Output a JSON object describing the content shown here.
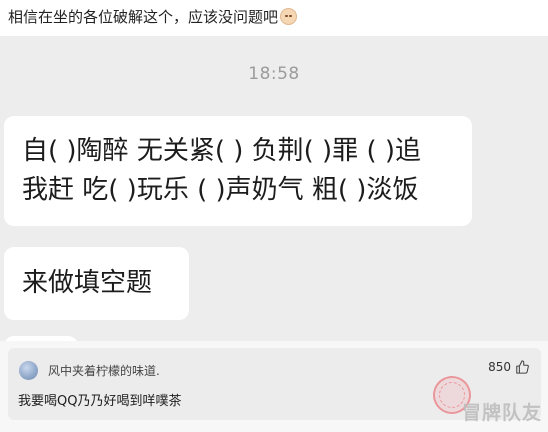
{
  "post": {
    "text": "相信在坐的各位破解这个，应该没问题吧",
    "emoji_icon": "grinning-face-icon"
  },
  "chat": {
    "timestamp": "18:58",
    "message1_line1": "自( )陶醉 无关紧( ) 负荆( )罪 ( )追",
    "message1_line2": "我赶 吃( )玩乐 ( )声奶气 粗( )淡饭",
    "message2": "来做填空题"
  },
  "comment": {
    "username": "风中夹着柠檬的味道.",
    "text": "我要喝QQ乃乃好喝到咩噗茶",
    "likes": "850",
    "like_icon": "thumbs-up-icon",
    "stamp_icon": "red-stamp-icon"
  },
  "watermark": "冒牌队友",
  "colors": {
    "chat_background": "#ededed",
    "bubble": "#ffffff",
    "timestamp": "#9c9c9c",
    "comment_card": "#ececec",
    "stamp": "#e76068"
  }
}
